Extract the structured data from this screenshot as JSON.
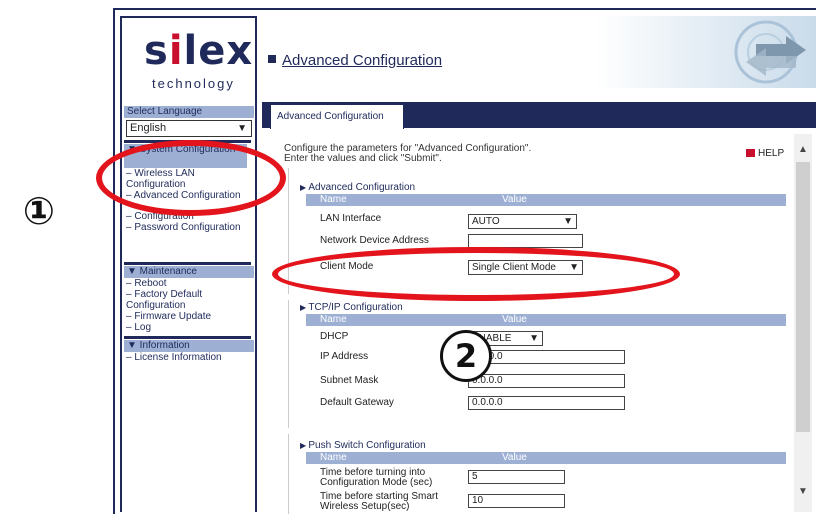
{
  "logo": {
    "brand_prefix": "s",
    "brand_i": "i",
    "brand_suffix": "lex",
    "tagline": "technology"
  },
  "sidebar": {
    "select_language_label": "Select Language",
    "language_value": "English",
    "system_config": {
      "header": "▼ System Configuration",
      "items": [
        "– Wireless LAN Configuration",
        "– Advanced Configuration",
        "– Configuration",
        "– Password Configuration"
      ]
    },
    "maintenance": {
      "header": "▼ Maintenance",
      "items": [
        "– Reboot",
        "– Factory Default Configuration",
        "– Firmware Update",
        "– Log"
      ]
    },
    "information": {
      "header": "▼ Information",
      "items": [
        "– License Information"
      ]
    }
  },
  "header": {
    "title": "Advanced Configuration"
  },
  "tab": {
    "label": "Advanced Configuration"
  },
  "content": {
    "desc_line1": "Configure the parameters for \"Advanced Configuration\".",
    "desc_line2": "Enter the values and click \"Submit\".",
    "help": "HELP"
  },
  "advanced": {
    "title": "Advanced Configuration",
    "col_name": "Name",
    "col_value": "Value",
    "rows": [
      {
        "label": "LAN Interface",
        "value": "AUTO"
      },
      {
        "label": "Network Device Address",
        "value": ""
      },
      {
        "label": "Client Mode",
        "value": "Single Client Mode"
      }
    ]
  },
  "tcpip": {
    "title": "TCP/IP Configuration",
    "col_name": "Name",
    "col_value": "Value",
    "rows": [
      {
        "label": "DHCP",
        "value": "ENABLE"
      },
      {
        "label": "IP Address",
        "value": "0.0.0.0"
      },
      {
        "label": "Subnet Mask",
        "value": "0.0.0.0"
      },
      {
        "label": "Default Gateway",
        "value": "0.0.0.0"
      }
    ]
  },
  "push": {
    "title": "Push Switch Configuration",
    "col_name": "Name",
    "col_value": "Value",
    "rows": [
      {
        "label1": "Time before turning into",
        "label2": "Configuration Mode (sec)",
        "value": "5"
      },
      {
        "label1": "Time before starting Smart",
        "label2": "Wireless Setup(sec)",
        "value": "10"
      }
    ]
  },
  "annotations": {
    "num1": "①",
    "num2": "2"
  },
  "colors": {
    "navy": "#1f2a5a",
    "accent": "#9db0d4",
    "highlight_red": "#e3141b"
  }
}
